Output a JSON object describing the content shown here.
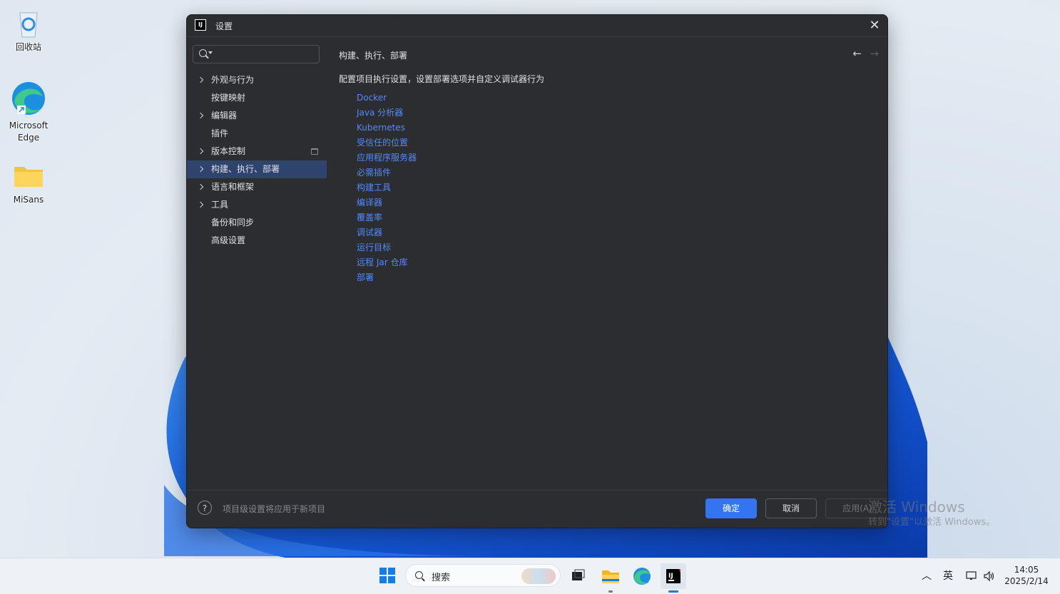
{
  "desktop": {
    "icons": [
      {
        "label": "回收站"
      },
      {
        "label": "Microsoft Edge"
      },
      {
        "label": "MiSans"
      }
    ]
  },
  "dialog": {
    "title": "设置",
    "search": {
      "value": "",
      "placeholder": ""
    },
    "sidebar": [
      {
        "label": "外观与行为",
        "expandable": true
      },
      {
        "label": "按键映射",
        "expandable": false
      },
      {
        "label": "编辑器",
        "expandable": true
      },
      {
        "label": "插件",
        "expandable": false
      },
      {
        "label": "版本控制",
        "expandable": true,
        "project_level": true
      },
      {
        "label": "构建、执行、部署",
        "expandable": true,
        "selected": true
      },
      {
        "label": "语言和框架",
        "expandable": true
      },
      {
        "label": "工具",
        "expandable": true
      },
      {
        "label": "备份和同步",
        "expandable": false
      },
      {
        "label": "高级设置",
        "expandable": false
      }
    ],
    "content": {
      "breadcrumb": "构建、执行、部署",
      "description": "配置项目执行设置，设置部署选项并自定义调试器行为",
      "links": [
        "Docker",
        "Java 分析器",
        "Kubernetes",
        "受信任的位置",
        "应用程序服务器",
        "必需插件",
        "构建工具",
        "编译器",
        "覆盖率",
        "调试器",
        "运行目标",
        "远程 Jar 仓库",
        "部署"
      ]
    },
    "footer": {
      "help": "?",
      "note": "项目级设置将应用于新项目",
      "ok": "确定",
      "cancel": "取消",
      "apply": "应用(A)"
    },
    "colors": {
      "accent": "#3574f0",
      "link": "#548af7",
      "background": "#2b2d30",
      "selection": "#2e436e"
    }
  },
  "watermark": {
    "line1": "激活 Windows",
    "line2": "转到\"设置\"以激活 Windows。"
  },
  "taskbar": {
    "search_label": "搜索",
    "input_method": "英",
    "time": "14:05",
    "date": "2025/2/14"
  }
}
